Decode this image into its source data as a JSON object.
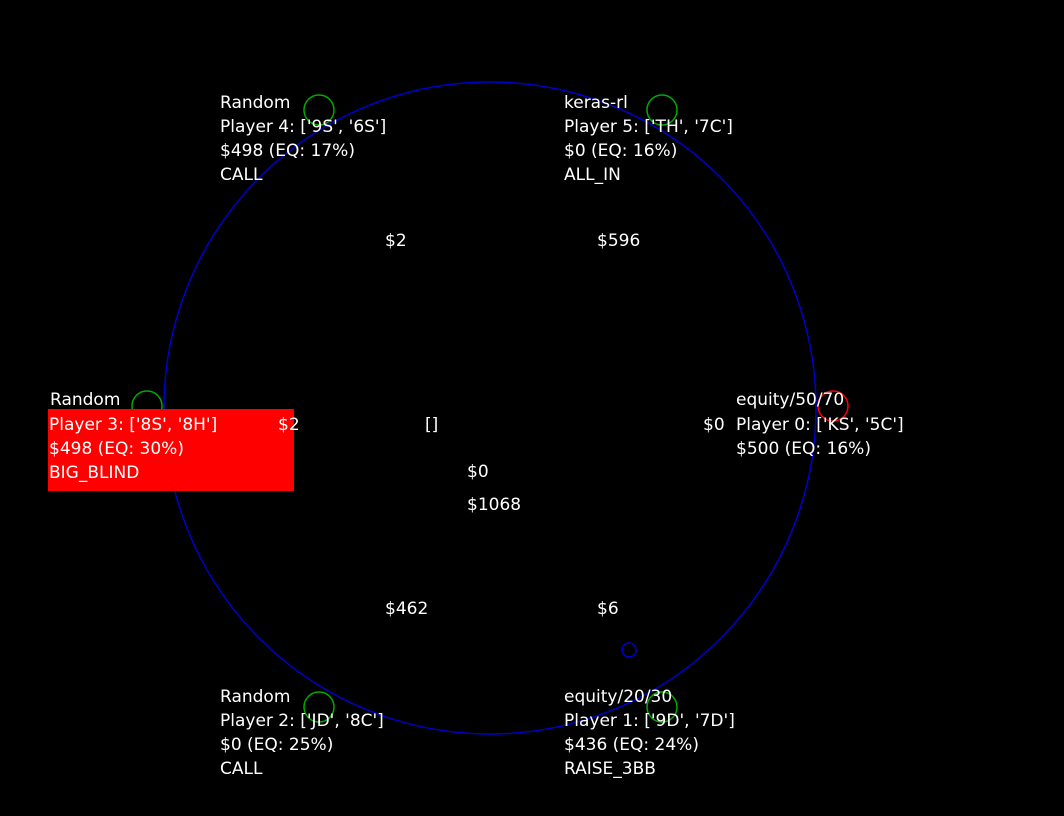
{
  "colors": {
    "background": "#000000",
    "table_outline": "#0000cc",
    "text": "#ffffff",
    "active_player_highlight": "#ff0000",
    "seat_marker": "#00aa00",
    "dealer_marker": "#ff0000"
  },
  "players": [
    {
      "seat": 4,
      "agent": "Random",
      "cards": "Player 4: ['9S', '6S']",
      "stack": "$498 (EQ: 17%)",
      "action": "CALL",
      "bet": "$2"
    },
    {
      "seat": 5,
      "agent": "keras-rl",
      "cards": "Player 5: ['TH', '7C']",
      "stack": "$0 (EQ: 16%)",
      "action": "ALL_IN",
      "bet": "$596"
    },
    {
      "seat": 3,
      "agent": "Random",
      "cards": "Player 3: ['8S', '8H']",
      "stack": "$498 (EQ: 30%)",
      "action": "BIG_BLIND",
      "bet": "$2",
      "active": true
    },
    {
      "seat": 0,
      "agent": "equity/50/70",
      "cards": "Player 0: ['KS', '5C']",
      "stack": "$500 (EQ: 16%)",
      "action": "",
      "bet": "$0"
    },
    {
      "seat": 2,
      "agent": "Random",
      "cards": "Player 2: ['JD', '8C']",
      "stack": "$0 (EQ: 25%)",
      "action": "CALL",
      "bet": "$462"
    },
    {
      "seat": 1,
      "agent": "equity/20/30",
      "cards": "Player 1: ['9D', '7D']",
      "stack": "$436 (EQ: 24%)",
      "action": "RAISE_3BB",
      "bet": "$6"
    }
  ],
  "board": {
    "community_cards": "[]",
    "current_round_pot": "$0",
    "total_pot": "$1068"
  }
}
